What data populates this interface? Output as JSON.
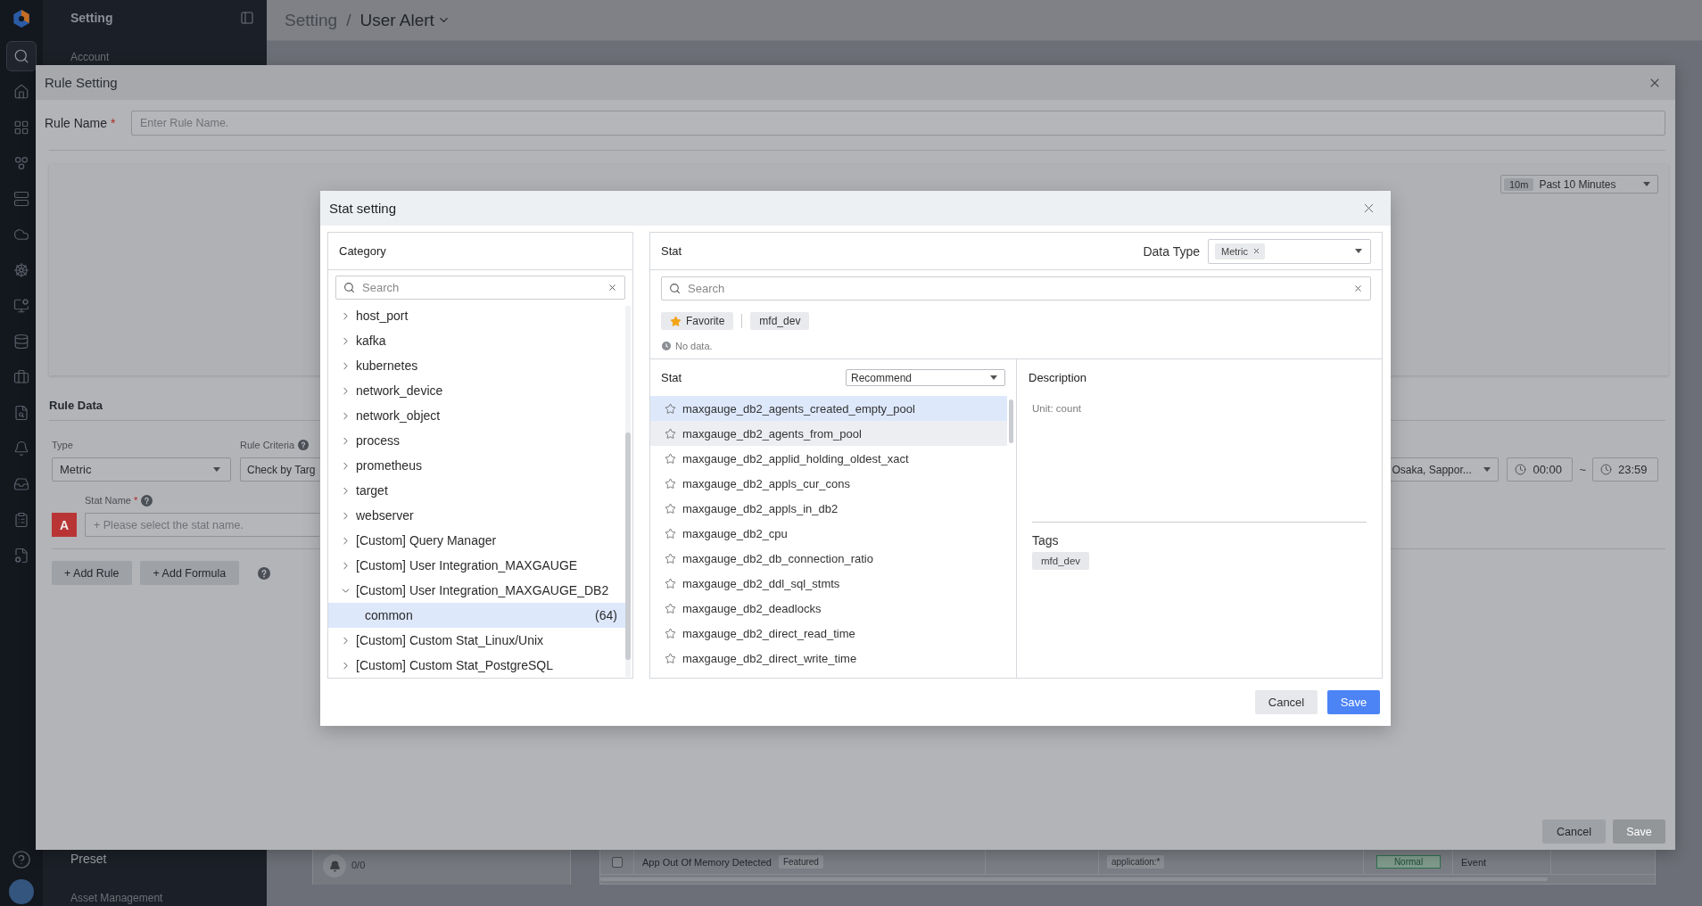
{
  "nav_rail": {
    "items": [
      {
        "selected": true
      },
      {
        "selected": false
      },
      {
        "selected": false
      },
      {
        "selected": false
      },
      {
        "selected": false
      },
      {
        "selected": false
      },
      {
        "selected": false
      },
      {
        "selected": false
      },
      {
        "selected": false
      },
      {
        "selected": false
      },
      {
        "selected": false
      },
      {
        "selected": false
      },
      {
        "selected": false
      },
      {
        "selected": false
      },
      {
        "selected": false
      }
    ]
  },
  "sidebar": {
    "title": "Setting",
    "top_items": [
      {
        "kind": "heading",
        "label": "Account"
      }
    ],
    "bottom_items": [
      {
        "kind": "item",
        "label": "Preset"
      },
      {
        "kind": "heading",
        "label": "Asset Management"
      }
    ]
  },
  "breadcrumb": {
    "items": [
      "Setting",
      "User Alert"
    ],
    "separator": "/"
  },
  "alert_list": {
    "summary": {
      "count": "0/0"
    },
    "table": {
      "rows": [
        {
          "checked": false,
          "cells": [
            {
              "kind": "title",
              "text": "App Out Of Memory Detected",
              "badge": "Featured"
            },
            {
              "kind": "empty"
            },
            {
              "kind": "tag",
              "text": "application:*"
            },
            {
              "kind": "status",
              "text": "Normal"
            },
            {
              "kind": "text",
              "text": "Event"
            },
            {
              "kind": "empty"
            }
          ]
        }
      ]
    }
  },
  "rule_setting": {
    "title": "Rule Setting",
    "rule_name": {
      "label": "Rule Name",
      "required_mark": "*",
      "placeholder": "Enter Rule Name."
    },
    "time_range": {
      "badge": "10m",
      "label": "Past 10 Minutes"
    },
    "rule_data": {
      "title": "Rule Data",
      "type": {
        "label": "Type",
        "value": "Metric"
      },
      "rule_criteria": {
        "label": "Rule Criteria",
        "value": "Check by Targ"
      },
      "stat_name": {
        "label": "Stat Name",
        "required_mark": "*",
        "badge": "A",
        "placeholder": "+ Please select the stat name."
      },
      "timezone": {
        "value": "Osaka, Sappor..."
      },
      "time_window": {
        "start": "00:00",
        "separator": "~",
        "end": "23:59"
      },
      "buttons": [
        "+ Add Rule",
        "+ Add Formula"
      ]
    },
    "footer": {
      "buttons": [
        {
          "label": "Cancel",
          "kind": "secondary",
          "disabled": false
        },
        {
          "label": "Save",
          "kind": "primary",
          "disabled": true
        }
      ]
    }
  },
  "stat_setting": {
    "title": "Stat setting",
    "category": {
      "title": "Category",
      "search": {
        "placeholder": "Search"
      },
      "items": [
        {
          "label": "host_port",
          "expanded": false,
          "selected": false
        },
        {
          "label": "kafka",
          "expanded": false,
          "selected": false
        },
        {
          "label": "kubernetes",
          "expanded": false,
          "selected": false
        },
        {
          "label": "network_device",
          "expanded": false,
          "selected": false
        },
        {
          "label": "network_object",
          "expanded": false,
          "selected": false
        },
        {
          "label": "process",
          "expanded": false,
          "selected": false
        },
        {
          "label": "prometheus",
          "expanded": false,
          "selected": false
        },
        {
          "label": "target",
          "expanded": false,
          "selected": false
        },
        {
          "label": "webserver",
          "expanded": false,
          "selected": false
        },
        {
          "label": "[Custom] Query Manager",
          "expanded": false,
          "selected": false
        },
        {
          "label": "[Custom] User Integration_MAXGAUGE",
          "expanded": false,
          "selected": false
        },
        {
          "label": "[Custom] User Integration_MAXGAUGE_DB2",
          "expanded": true,
          "selected": false,
          "children": [
            {
              "label": "common",
              "count": "(64)",
              "selected": true
            }
          ]
        },
        {
          "label": "[Custom] Custom Stat_Linux/Unix",
          "expanded": false,
          "selected": false
        },
        {
          "label": "[Custom] Custom Stat_PostgreSQL",
          "expanded": false,
          "selected": false
        }
      ]
    },
    "stat": {
      "title": "Stat",
      "data_type": {
        "label": "Data Type",
        "tags": [
          "Metric"
        ]
      },
      "search": {
        "placeholder": "Search"
      },
      "chips": [
        {
          "kind": "favorite",
          "label": "Favorite"
        },
        {
          "kind": "tag",
          "label": "mfd_dev"
        }
      ],
      "message": "No data."
    },
    "stat_list": {
      "title": "Stat",
      "sort": "Recommend",
      "items": [
        {
          "label": "maxgauge_db2_agents_created_empty_pool",
          "favorite": false,
          "selected": true,
          "hovered": false
        },
        {
          "label": "maxgauge_db2_agents_from_pool",
          "favorite": false,
          "selected": false,
          "hovered": true
        },
        {
          "label": "maxgauge_db2_applid_holding_oldest_xact",
          "favorite": false,
          "selected": false,
          "hovered": false
        },
        {
          "label": "maxgauge_db2_appls_cur_cons",
          "favorite": false,
          "selected": false,
          "hovered": false
        },
        {
          "label": "maxgauge_db2_appls_in_db2",
          "favorite": false,
          "selected": false,
          "hovered": false
        },
        {
          "label": "maxgauge_db2_cpu",
          "favorite": false,
          "selected": false,
          "hovered": false
        },
        {
          "label": "maxgauge_db2_db_connection_ratio",
          "favorite": false,
          "selected": false,
          "hovered": false
        },
        {
          "label": "maxgauge_db2_ddl_sql_stmts",
          "favorite": false,
          "selected": false,
          "hovered": false
        },
        {
          "label": "maxgauge_db2_deadlocks",
          "favorite": false,
          "selected": false,
          "hovered": false
        },
        {
          "label": "maxgauge_db2_direct_read_time",
          "favorite": false,
          "selected": false,
          "hovered": false
        },
        {
          "label": "maxgauge_db2_direct_write_time",
          "favorite": false,
          "selected": false,
          "hovered": false
        }
      ]
    },
    "description": {
      "title": "Description",
      "unit": "Unit: count",
      "tags_title": "Tags",
      "tags": [
        "mfd_dev"
      ]
    },
    "buttons": [
      {
        "label": "Cancel",
        "kind": "secondary",
        "disabled": false
      },
      {
        "label": "Save",
        "kind": "primary",
        "disabled": false
      }
    ]
  }
}
